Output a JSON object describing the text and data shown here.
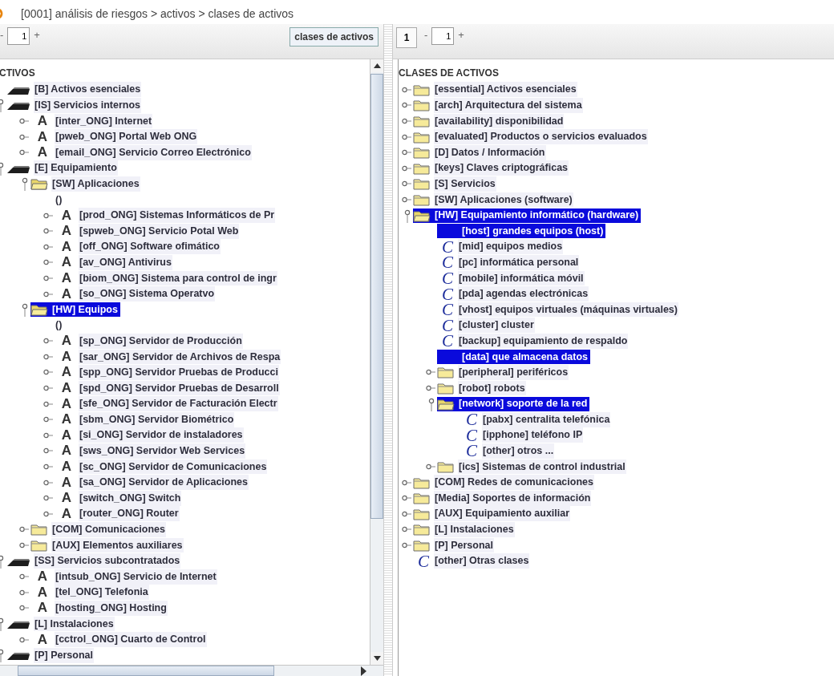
{
  "title": "[0001] análisis de riesgos > activos > clases de activos",
  "left_panel": {
    "toolbar": {
      "minus": "-",
      "page_field": "1",
      "plus": "+",
      "button": "clases de activos"
    },
    "tree": {
      "header": "CTIVOS",
      "nodes": [
        {
          "kind": "layer",
          "label": "[B] Activos esenciales",
          "selected": false
        },
        {
          "kind": "layer",
          "label": "[IS] Servicios internos",
          "expanded": true,
          "selected": false,
          "children": [
            {
              "kind": "asset",
              "icon": "A",
              "label": "[inter_ONG] Internet",
              "expanded": false,
              "selected": false
            },
            {
              "kind": "asset",
              "icon": "A",
              "label": "[pweb_ONG] Portal Web ONG",
              "expanded": false,
              "selected": false
            },
            {
              "kind": "asset",
              "icon": "A",
              "label": "[email_ONG] Servicio Correo Electrónico",
              "expanded": false,
              "selected": false
            }
          ]
        },
        {
          "kind": "layer",
          "label": "[E] Equipamiento",
          "expanded": true,
          "selected": false,
          "children": [
            {
              "kind": "folder",
              "label": "[SW] Aplicaciones",
              "expanded": true,
              "selected": false,
              "children": [
                {
                  "kind": "empty",
                  "label": "()",
                  "selected": false
                },
                {
                  "kind": "asset",
                  "icon": "A",
                  "label": "[prod_ONG] Sistemas Informáticos de Pr",
                  "expanded": false,
                  "selected": false
                },
                {
                  "kind": "asset",
                  "icon": "A",
                  "label": "[spweb_ONG] Servicio Potal Web",
                  "expanded": false,
                  "selected": false
                },
                {
                  "kind": "asset",
                  "icon": "A",
                  "label": "[off_ONG] Software ofimático",
                  "expanded": false,
                  "selected": false
                },
                {
                  "kind": "asset",
                  "icon": "A",
                  "label": "[av_ONG] Antivirus",
                  "expanded": false,
                  "selected": false
                },
                {
                  "kind": "asset",
                  "icon": "A",
                  "label": "[biom_ONG] Sistema para control de ingr",
                  "expanded": false,
                  "selected": false
                },
                {
                  "kind": "asset",
                  "icon": "A",
                  "label": "[so_ONG] Sistema Operatvo",
                  "expanded": false,
                  "selected": false
                }
              ]
            },
            {
              "kind": "folder",
              "label": "[HW] Equipos",
              "expanded": true,
              "selected": true,
              "children": [
                {
                  "kind": "empty",
                  "label": "()",
                  "selected": false
                },
                {
                  "kind": "asset",
                  "icon": "A",
                  "label": "[sp_ONG] Servidor de Producción",
                  "expanded": false,
                  "selected": false
                },
                {
                  "kind": "asset",
                  "icon": "A",
                  "label": "[sar_ONG] Servidor de Archivos de Respa",
                  "expanded": false,
                  "selected": false
                },
                {
                  "kind": "asset",
                  "icon": "A",
                  "label": "[spp_ONG] Servidor Pruebas de Producci",
                  "expanded": false,
                  "selected": false
                },
                {
                  "kind": "asset",
                  "icon": "A",
                  "label": "[spd_ONG] Servidor Pruebas de Desarroll",
                  "expanded": false,
                  "selected": false
                },
                {
                  "kind": "asset",
                  "icon": "A",
                  "label": "[sfe_ONG] Servidor de Facturación Electr",
                  "expanded": false,
                  "selected": false
                },
                {
                  "kind": "asset",
                  "icon": "A",
                  "label": "[sbm_ONG] Servidor Biométrico",
                  "expanded": false,
                  "selected": false
                },
                {
                  "kind": "asset",
                  "icon": "A",
                  "label": "[si_ONG] Servidor de instaladores",
                  "expanded": false,
                  "selected": false
                },
                {
                  "kind": "asset",
                  "icon": "A",
                  "label": "[sws_ONG] Servidor Web Services",
                  "expanded": false,
                  "selected": false
                },
                {
                  "kind": "asset",
                  "icon": "A",
                  "label": "[sc_ONG] Servidor de Comunicaciones",
                  "expanded": false,
                  "selected": false
                },
                {
                  "kind": "asset",
                  "icon": "A",
                  "label": "[sa_ONG] Servidor de Aplicaciones",
                  "expanded": false,
                  "selected": false
                },
                {
                  "kind": "asset",
                  "icon": "A",
                  "label": "[switch_ONG] Switch",
                  "expanded": false,
                  "selected": false
                },
                {
                  "kind": "asset",
                  "icon": "A",
                  "label": "[router_ONG] Router",
                  "expanded": false,
                  "selected": false
                }
              ]
            },
            {
              "kind": "folder",
              "label": "[COM] Comunicaciones",
              "expanded": false,
              "selected": false
            },
            {
              "kind": "folder",
              "label": "[AUX] Elementos auxiliares",
              "expanded": false,
              "selected": false
            }
          ]
        },
        {
          "kind": "layer",
          "label": "[SS] Servicios subcontratados",
          "expanded": true,
          "selected": false,
          "children": [
            {
              "kind": "asset",
              "icon": "A",
              "label": "[intsub_ONG] Servicio de Internet",
              "expanded": false,
              "selected": false
            },
            {
              "kind": "asset",
              "icon": "A",
              "label": "[tel_ONG] Telefonia",
              "expanded": false,
              "selected": false
            },
            {
              "kind": "asset",
              "icon": "A",
              "label": "[hosting_ONG] Hosting",
              "expanded": false,
              "selected": false
            }
          ]
        },
        {
          "kind": "layer",
          "label": "[L] Instalaciones",
          "expanded": true,
          "selected": false,
          "children": [
            {
              "kind": "asset",
              "icon": "A",
              "label": "[cctrol_ONG] Cuarto de Control",
              "expanded": false,
              "selected": false
            }
          ]
        },
        {
          "kind": "layer",
          "label": "[P] Personal",
          "expanded": true,
          "selected": false
        }
      ]
    }
  },
  "right_panel": {
    "toolbar": {
      "page_button": "1",
      "minus": "-",
      "page_field": "1",
      "plus": "+"
    },
    "tree": {
      "header": "CLASES DE ACTIVOS",
      "nodes": [
        {
          "kind": "folder",
          "label": "[essential] Activos esenciales",
          "expanded": false,
          "selected": false
        },
        {
          "kind": "folder",
          "label": "[arch] Arquitectura del sistema",
          "expanded": false,
          "selected": false
        },
        {
          "kind": "folder",
          "label": "[availability] disponibilidad",
          "expanded": false,
          "selected": false
        },
        {
          "kind": "folder",
          "label": "[evaluated] Productos o servicios evaluados",
          "expanded": false,
          "selected": false
        },
        {
          "kind": "folder",
          "label": "[D] Datos / Información",
          "expanded": false,
          "selected": false
        },
        {
          "kind": "folder",
          "label": "[keys] Claves criptográficas",
          "expanded": false,
          "selected": false
        },
        {
          "kind": "folder",
          "label": "[S] Servicios",
          "expanded": false,
          "selected": false
        },
        {
          "kind": "folder",
          "label": "[SW] Aplicaciones (software)",
          "expanded": false,
          "selected": false
        },
        {
          "kind": "folder",
          "label": "[HW] Equipamiento informático (hardware)",
          "expanded": true,
          "selected": true,
          "children": [
            {
              "kind": "class",
              "label": "[host] grandes equipos (host)",
              "selected": true
            },
            {
              "kind": "class",
              "icon": "C",
              "label": "[mid] equipos medios",
              "selected": false
            },
            {
              "kind": "class",
              "icon": "C",
              "label": "[pc] informática personal",
              "selected": false
            },
            {
              "kind": "class",
              "icon": "C",
              "label": "[mobile] informática móvil",
              "selected": false
            },
            {
              "kind": "class",
              "icon": "C",
              "label": "[pda] agendas electrónicas",
              "selected": false
            },
            {
              "kind": "class",
              "icon": "C",
              "label": "[vhost] equipos virtuales (máquinas virtuales)",
              "selected": false
            },
            {
              "kind": "class",
              "icon": "C",
              "label": "[cluster] cluster",
              "selected": false
            },
            {
              "kind": "class",
              "icon": "C",
              "label": "[backup] equipamiento de respaldo",
              "selected": false
            },
            {
              "kind": "class",
              "label": "[data] que almacena datos",
              "selected": true
            },
            {
              "kind": "folder",
              "label": "[peripheral] periféricos",
              "expanded": false,
              "selected": false
            },
            {
              "kind": "folder",
              "label": "[robot] robots",
              "expanded": false,
              "selected": false
            },
            {
              "kind": "folder",
              "label": "[network] soporte de la red",
              "expanded": true,
              "selected": true,
              "children": [
                {
                  "kind": "class",
                  "icon": "C",
                  "label": "[pabx] centralita telefónica",
                  "selected": false
                },
                {
                  "kind": "class",
                  "icon": "C",
                  "label": "[ipphone] teléfono IP",
                  "selected": false
                },
                {
                  "kind": "class",
                  "icon": "C",
                  "label": "[other] otros ...",
                  "selected": false
                }
              ]
            },
            {
              "kind": "folder",
              "label": "[ics] Sistemas de control industrial",
              "expanded": false,
              "selected": false
            }
          ]
        },
        {
          "kind": "folder",
          "label": "[COM] Redes de comunicaciones",
          "expanded": false,
          "selected": false
        },
        {
          "kind": "folder",
          "label": "[Media] Soportes de información",
          "expanded": false,
          "selected": false
        },
        {
          "kind": "folder",
          "label": "[AUX] Equipamiento auxiliar",
          "expanded": false,
          "selected": false
        },
        {
          "kind": "folder",
          "label": "[L] Instalaciones",
          "expanded": false,
          "selected": false
        },
        {
          "kind": "folder",
          "label": "[P] Personal",
          "expanded": false,
          "selected": false
        },
        {
          "kind": "class",
          "icon": "C",
          "label": "[other] Otras clases",
          "selected": false
        }
      ]
    }
  }
}
